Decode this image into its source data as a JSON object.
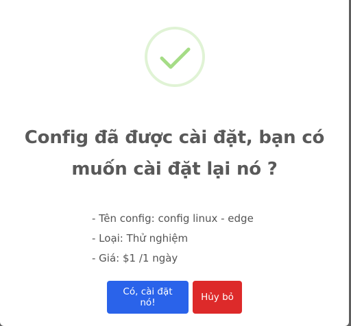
{
  "dialog": {
    "icon": "success-check-icon",
    "colors": {
      "icon_ring": "#dcf1d0",
      "icon_check": "#a5dc86",
      "title": "#595959",
      "text": "#545454",
      "confirm_button": "#2a63ea",
      "cancel_button": "#dd2a2a"
    },
    "title_line1": "Config đã được cài đặt, bạn có",
    "title_line2": "muốn cài đặt lại nó ?",
    "info": {
      "config_name": "- Tên config: config linux - edge",
      "type": "- Loại: Thử nghiệm",
      "price": "- Giá: $1 /1 ngày"
    },
    "buttons": {
      "confirm_label": "Có, cài đặt nó!",
      "cancel_label": "Hủy bỏ"
    }
  }
}
